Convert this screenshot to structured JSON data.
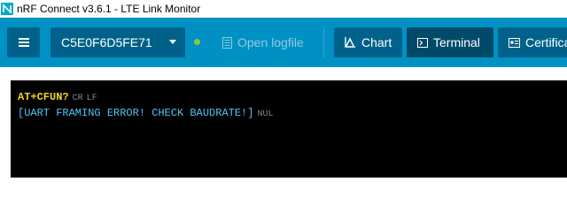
{
  "window": {
    "title": "nRF Connect v3.6.1 - LTE Link Monitor"
  },
  "toolbar": {
    "menu_icon": "hamburger-icon",
    "device": "C5E0F6D5FE71",
    "device_caret_icon": "caret-down-icon",
    "status_color": "#8dc63f",
    "open_logfile": "Open logfile",
    "tabs": [
      {
        "label": "Chart",
        "icon": "chart-icon"
      },
      {
        "label": "Terminal",
        "icon": "terminal-icon",
        "active": true
      },
      {
        "label": "Certifica",
        "icon": "certificate-icon"
      }
    ]
  },
  "terminal": {
    "lines": [
      {
        "text": "AT+CFUN?",
        "controls": [
          "CR",
          "LF"
        ]
      },
      {
        "text": "[UART FRAMING ERROR! CHECK BAUDRATE!]",
        "controls": [
          "NUL"
        ]
      }
    ]
  },
  "colors": {
    "toolbar": "#0091c4",
    "button": "#00628a",
    "active_tab": "#004a69",
    "command_text": "#f7d21f",
    "response_text": "#4fc3f7"
  }
}
